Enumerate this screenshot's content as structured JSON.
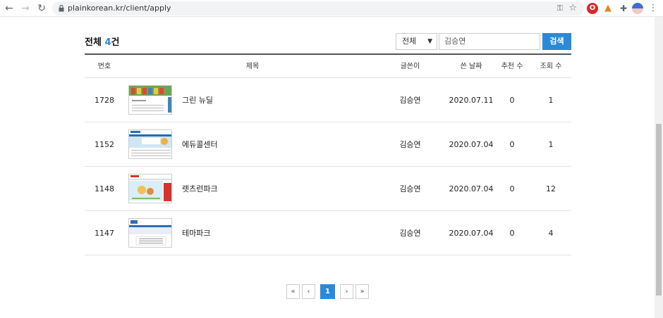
{
  "browser": {
    "url": "plainkorean.kr/client/apply"
  },
  "summary": {
    "prefix": "전체",
    "count": "4",
    "suffix": "건"
  },
  "search": {
    "filter_value": "전체",
    "query_value": "김승연",
    "button_label": "검색"
  },
  "table": {
    "headers": {
      "num": "번호",
      "title": "제목",
      "writer": "글쓴이",
      "date": "쓴 날짜",
      "recommend": "추천 수",
      "views": "조회 수"
    },
    "rows": [
      {
        "num": "1728",
        "title": "그린 뉴딜",
        "writer": "김승연",
        "date": "2020.07.11",
        "recommend": "0",
        "views": "1"
      },
      {
        "num": "1152",
        "title": "에듀콜센터",
        "writer": "김승연",
        "date": "2020.07.04",
        "recommend": "0",
        "views": "1"
      },
      {
        "num": "1148",
        "title": "렛츠런파크",
        "writer": "김승연",
        "date": "2020.07.04",
        "recommend": "0",
        "views": "12"
      },
      {
        "num": "1147",
        "title": "테마파크",
        "writer": "김승연",
        "date": "2020.07.04",
        "recommend": "0",
        "views": "4"
      }
    ]
  },
  "pagination": {
    "first": "«",
    "prev": "‹",
    "current": "1",
    "next": "›",
    "last": "»"
  },
  "colors": {
    "accent": "#2b8ad8"
  }
}
